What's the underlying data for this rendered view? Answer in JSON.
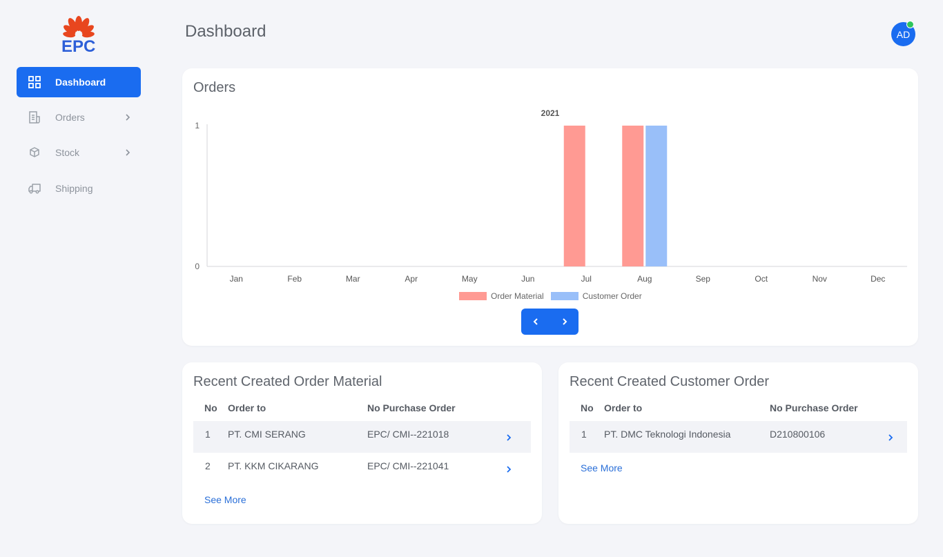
{
  "brand": {
    "logo_text": "EPC",
    "accent": "#1a6cf0"
  },
  "sidebar": {
    "items": [
      {
        "label": "Dashboard",
        "icon": "grid-icon",
        "active": true
      },
      {
        "label": "Orders",
        "icon": "receipt-icon",
        "has_submenu": true
      },
      {
        "label": "Stock",
        "icon": "box-icon",
        "has_submenu": true
      },
      {
        "label": "Shipping",
        "icon": "truck-icon"
      }
    ]
  },
  "header": {
    "title": "Dashboard",
    "avatar_initials": "AD",
    "status_color": "#2ec55c"
  },
  "orders_card": {
    "title": "Orders",
    "pager": {
      "prev_icon": "chevron-left-icon",
      "next_icon": "chevron-right-icon"
    }
  },
  "chart_data": {
    "type": "bar",
    "title": "2021",
    "categories": [
      "Jan",
      "Feb",
      "Mar",
      "Apr",
      "May",
      "Jun",
      "Jul",
      "Aug",
      "Sep",
      "Oct",
      "Nov",
      "Dec"
    ],
    "series": [
      {
        "name": "Order Material",
        "color": "#ff9a93",
        "values": [
          0,
          0,
          0,
          0,
          0,
          0,
          1,
          1,
          0,
          0,
          0,
          0
        ]
      },
      {
        "name": "Customer Order",
        "color": "#99bff9",
        "values": [
          0,
          0,
          0,
          0,
          0,
          0,
          0,
          1,
          0,
          0,
          0,
          0
        ]
      }
    ],
    "ylim": [
      0,
      1
    ],
    "yticks": [
      "0",
      "1"
    ],
    "legend": "bottom-center",
    "grid": false
  },
  "recent_order_material": {
    "title": "Recent Created Order Material",
    "columns": [
      "No",
      "Order to",
      "No Purchase Order"
    ],
    "rows": [
      {
        "no": "1",
        "order_to": "PT. CMI SERANG",
        "po": "EPC/ CMI--221018"
      },
      {
        "no": "2",
        "order_to": "PT. KKM CIKARANG",
        "po": "EPC/ CMI--221041"
      }
    ],
    "see_more": "See More"
  },
  "recent_customer_order": {
    "title": "Recent Created Customer Order",
    "columns": [
      "No",
      "Order to",
      "No Purchase Order"
    ],
    "rows": [
      {
        "no": "1",
        "order_to": "PT. DMC Teknologi Indonesia",
        "po": "D210800106"
      }
    ],
    "see_more": "See More"
  }
}
